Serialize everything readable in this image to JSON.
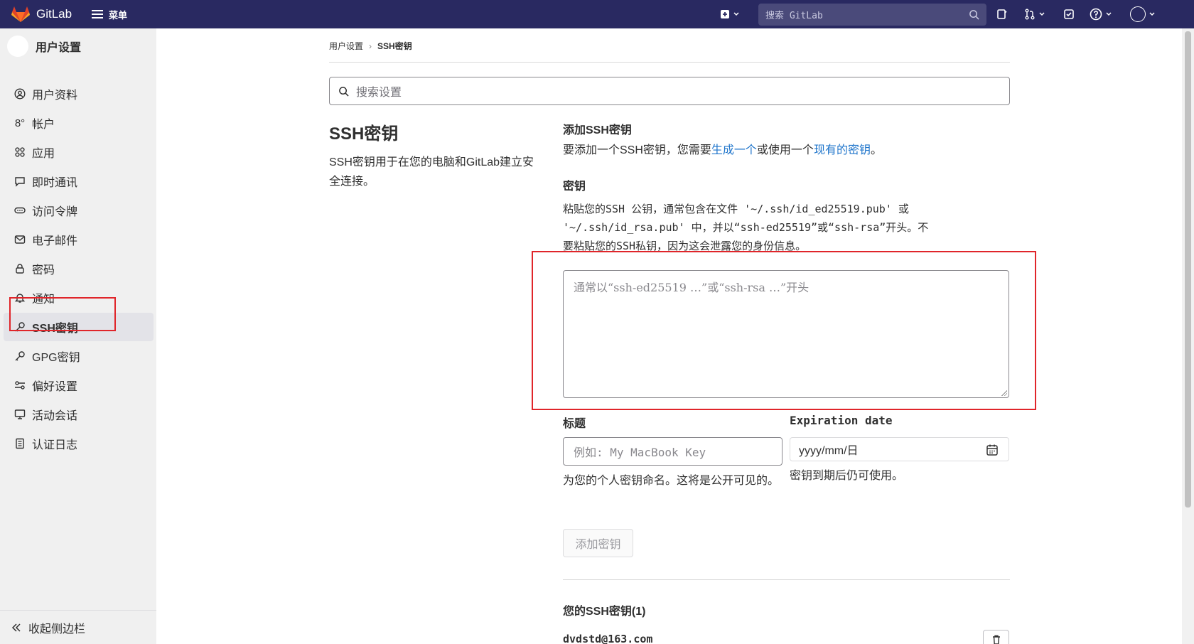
{
  "topbar": {
    "brand": "GitLab",
    "menu_label": "菜单",
    "search_placeholder": "搜索 GitLab",
    "icons": [
      "plus-square-icon",
      "chevron-down-icon",
      "search-icon",
      "issues-icon",
      "merge-request-icon",
      "todo-icon",
      "help-icon",
      "avatar-icon"
    ]
  },
  "sidebar": {
    "title": "用户设置",
    "items": [
      {
        "label": "用户资料",
        "icon": "profile-icon"
      },
      {
        "label": "帐户",
        "icon": "account-icon"
      },
      {
        "label": "应用",
        "icon": "applications-icon"
      },
      {
        "label": "即时通讯",
        "icon": "chat-icon"
      },
      {
        "label": "访问令牌",
        "icon": "token-icon"
      },
      {
        "label": "电子邮件",
        "icon": "mail-icon"
      },
      {
        "label": "密码",
        "icon": "lock-icon"
      },
      {
        "label": "通知",
        "icon": "bell-icon"
      },
      {
        "label": "SSH密钥",
        "icon": "key-icon",
        "active": true
      },
      {
        "label": "GPG密钥",
        "icon": "key-icon"
      },
      {
        "label": "偏好设置",
        "icon": "preferences-icon"
      },
      {
        "label": "活动会话",
        "icon": "monitor-icon"
      },
      {
        "label": "认证日志",
        "icon": "log-icon"
      }
    ],
    "collapse_label": "收起侧边栏"
  },
  "breadcrumb": {
    "parent": "用户设置",
    "current": "SSH密钥"
  },
  "settings_search_placeholder": "搜索设置",
  "section": {
    "title": "SSH密钥",
    "description": "SSH密钥用于在您的电脑和GitLab建立安全连接。"
  },
  "add_key": {
    "heading": "添加SSH密钥",
    "intro_before": "要添加一个SSH密钥，您需要",
    "intro_link1": "生成一个",
    "intro_middle": "或使用一个",
    "intro_link2": "现有的密钥",
    "intro_after": "。",
    "key_label": "密钥",
    "key_help_line1": "粘贴您的SSH 公钥，通常包含在文件 '~/.ssh/id_ed25519.pub' 或",
    "key_help_line2": "'~/.ssh/id_rsa.pub' 中，并以“ssh-ed25519”或“ssh-rsa”开头。不",
    "key_help_line3": "要粘贴您的SSH私钥，因为这会泄露您的身份信息。",
    "key_placeholder": "通常以“ssh-ed25519 …”或“ssh-rsa …”开头",
    "title_label": "标题",
    "title_placeholder": "例如: My MacBook Key",
    "title_help": "为您的个人密钥命名。这将是公开可见的。",
    "expiration_label": "Expiration date",
    "expiration_placeholder": "yyyy/mm/日",
    "expiration_help": "密钥到期后仍可使用。",
    "submit_label": "添加密钥"
  },
  "your_keys": {
    "heading": "您的SSH密钥(1)",
    "keys": [
      {
        "title": "dvdstd@163.com"
      }
    ]
  },
  "colors": {
    "topbar": "#292961",
    "sidebar": "#f0f0f0",
    "link": "#1f75cb",
    "highlight": "#e0252a"
  }
}
